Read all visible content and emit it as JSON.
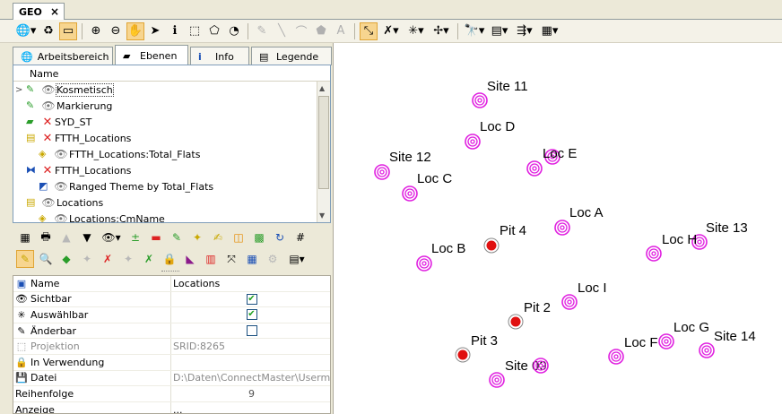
{
  "window": {
    "tab_title": "GEO",
    "close_glyph": "×"
  },
  "panel_tabs": [
    {
      "label": "Arbeitsbereich",
      "icon": "globe-icon"
    },
    {
      "label": "Ebenen",
      "icon": "layers-icon",
      "active": true
    },
    {
      "label": "Info",
      "icon": "info-icon"
    },
    {
      "label": "Legende",
      "icon": "legend-icon"
    }
  ],
  "layers": {
    "column_header": "Name",
    "rows": [
      {
        "label": "Kosmetisch"
      },
      {
        "label": "Markierung"
      },
      {
        "label": "SYD_ST"
      },
      {
        "label": "FTTH_Locations"
      },
      {
        "label": "FTTH_Locations:Total_Flats"
      },
      {
        "label": "FTTH_Locations"
      },
      {
        "label": "Ranged Theme by Total_Flats"
      },
      {
        "label": "Locations"
      },
      {
        "label": "Locations:CmName"
      }
    ]
  },
  "properties": {
    "rows": [
      {
        "key": "Name",
        "value": "Locations"
      },
      {
        "key": "Sichtbar",
        "checked": true
      },
      {
        "key": "Auswählbar",
        "checked": true
      },
      {
        "key": "Änderbar",
        "checked": false
      },
      {
        "key": "Projektion",
        "value": "SRID:8265"
      },
      {
        "key": "In Verwendung",
        "value": ""
      },
      {
        "key": "Datei",
        "value": "D:\\Daten\\ConnectMaster\\Userm..."
      },
      {
        "key": "Reihenfolge",
        "value": "9"
      },
      {
        "key": "Anzeige",
        "value": "..."
      }
    ]
  },
  "map": {
    "features": [
      {
        "label": "Site 11",
        "kind": "site"
      },
      {
        "label": "Loc D",
        "kind": "loc"
      },
      {
        "label": "Loc E",
        "kind": "loc"
      },
      {
        "label": "Site 12",
        "kind": "site"
      },
      {
        "label": "Loc C",
        "kind": "loc"
      },
      {
        "label": "Loc A",
        "kind": "loc"
      },
      {
        "label": "Pit 4",
        "kind": "pit"
      },
      {
        "label": "Site 13",
        "kind": "site"
      },
      {
        "label": "Loc B",
        "kind": "loc"
      },
      {
        "label": "Loc H",
        "kind": "loc"
      },
      {
        "label": "Loc I",
        "kind": "loc"
      },
      {
        "label": "Pit 2",
        "kind": "pit"
      },
      {
        "label": "Loc G",
        "kind": "loc"
      },
      {
        "label": "Site 14",
        "kind": "site"
      },
      {
        "label": "Pit 3",
        "kind": "pit"
      },
      {
        "label": "Loc F",
        "kind": "loc"
      },
      {
        "label": "Site 09",
        "kind": "site"
      }
    ],
    "colors": {
      "location_marker": "#e020e0",
      "pit_marker": "#e01010",
      "background": "#ffffff"
    }
  }
}
